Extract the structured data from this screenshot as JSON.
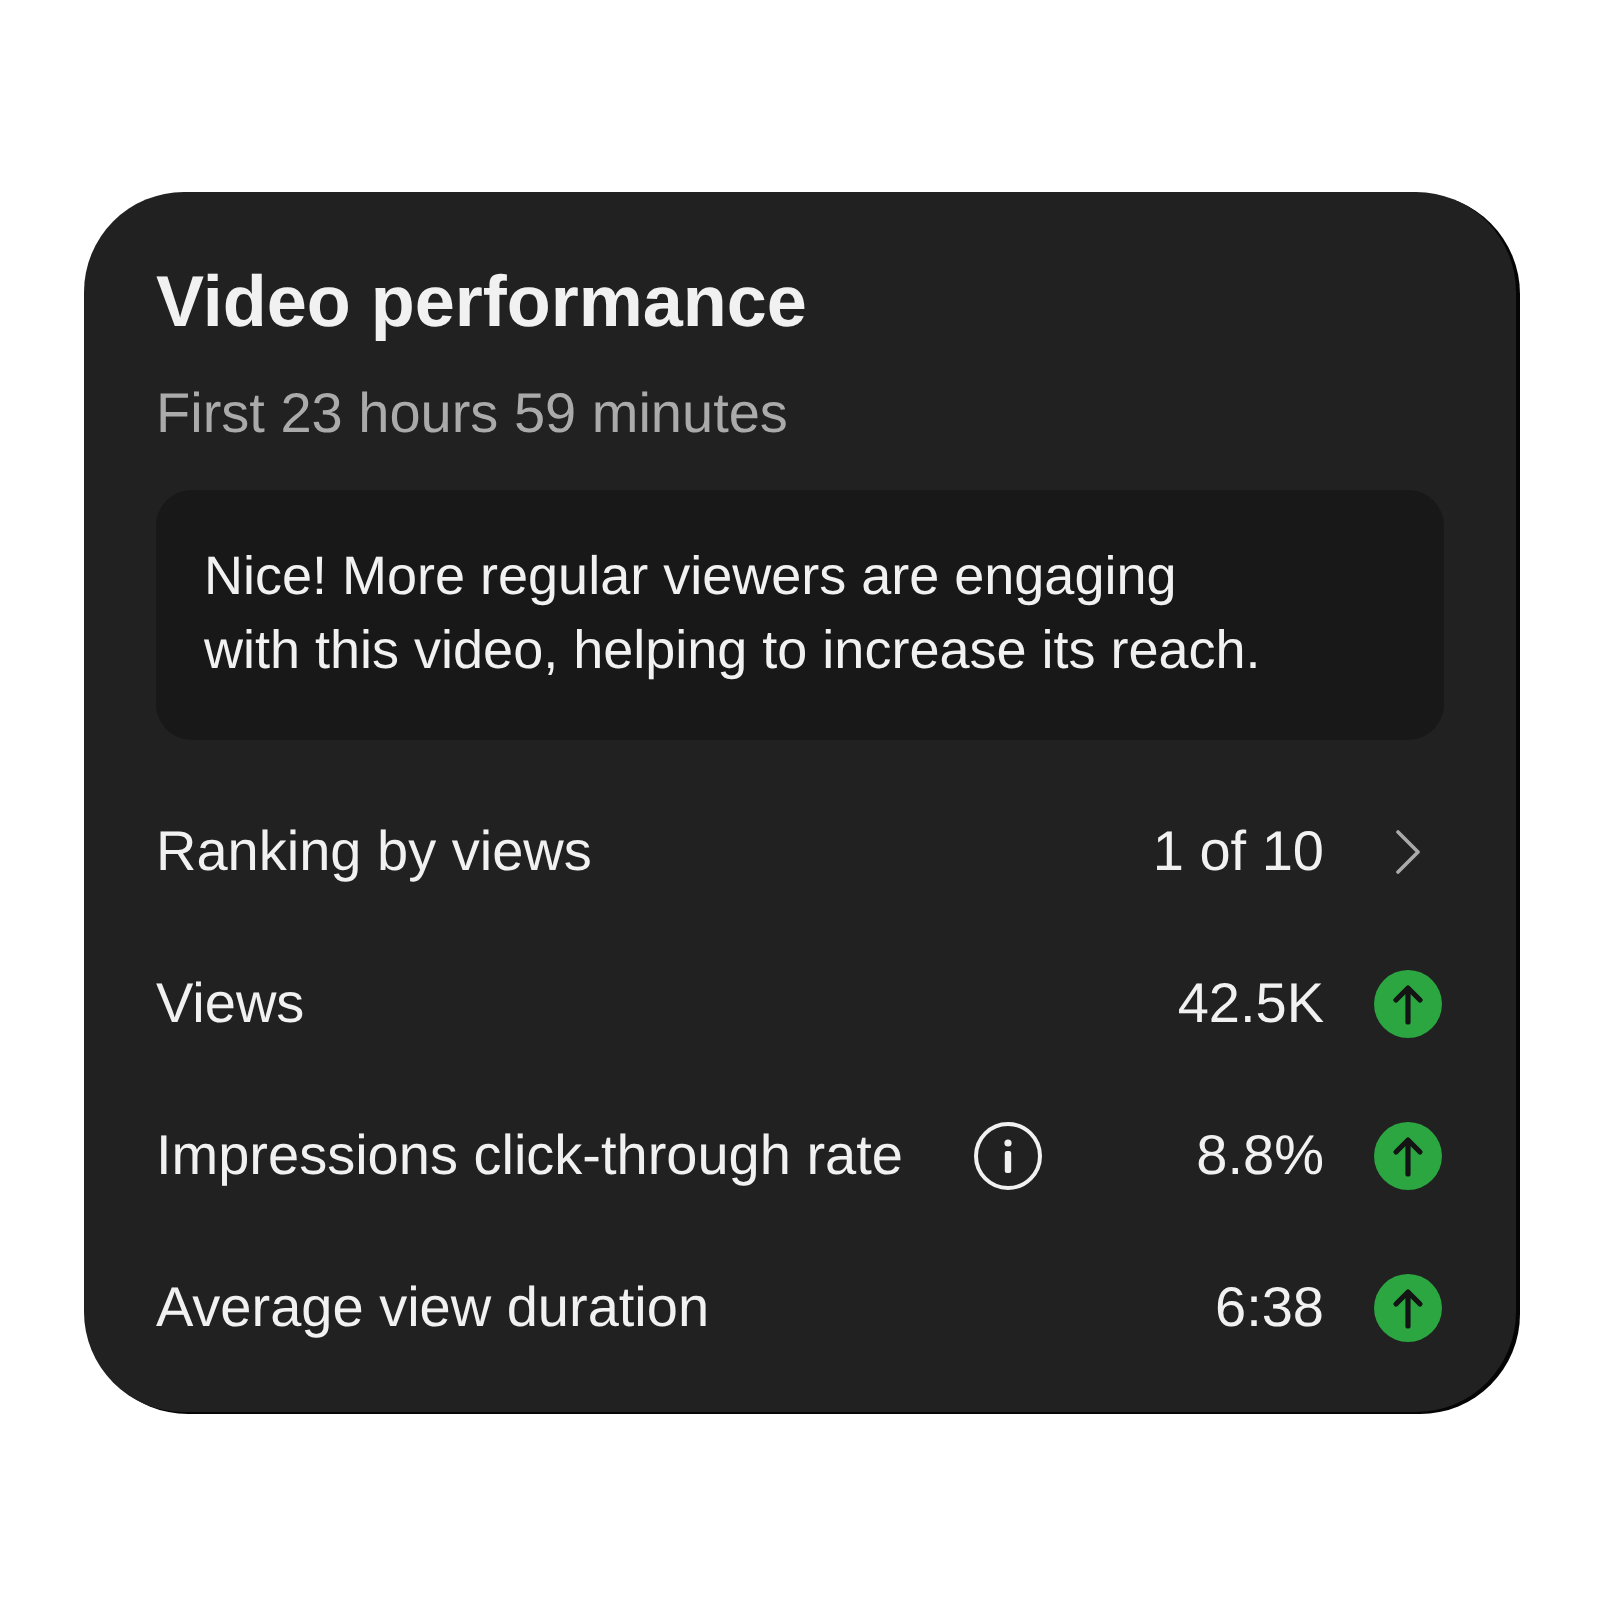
{
  "card": {
    "title": "Video performance",
    "subtitle": "First 23 hours 59 minutes",
    "message": "Nice! More regular viewers are engaging with this video, helping to increase its reach.",
    "metrics": [
      {
        "label": "Ranking by views",
        "info": false,
        "value": "1 of 10",
        "kind": "link"
      },
      {
        "label": "Views",
        "info": false,
        "value": "42.5K",
        "kind": "up"
      },
      {
        "label": "Impressions click-through rate",
        "info": true,
        "value": "8.8%",
        "kind": "up"
      },
      {
        "label": "Average view duration",
        "info": false,
        "value": "6:38",
        "kind": "up"
      }
    ]
  }
}
